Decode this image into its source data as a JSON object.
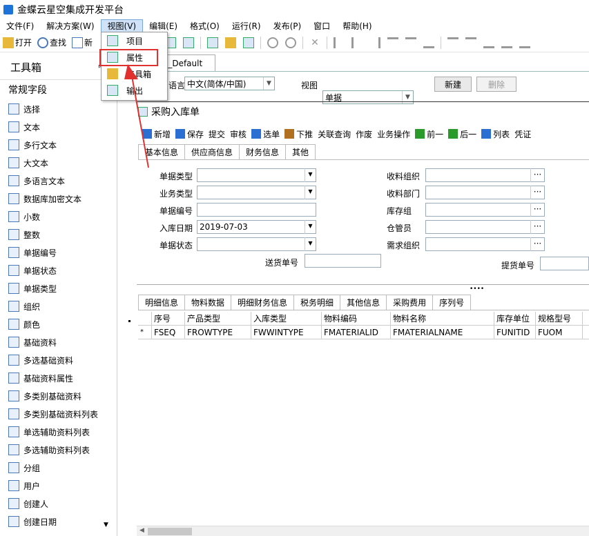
{
  "title": "金蝶云星空集成开发平台",
  "menu": [
    "文件(F)",
    "解决方案(W)",
    "视图(V)",
    "编辑(E)",
    "格式(O)",
    "运行(R)",
    "发布(P)",
    "窗口",
    "帮助(H)"
  ],
  "toolbar": {
    "open": "打开",
    "find": "查找",
    "new": "新"
  },
  "dropdown": [
    "项目",
    "属性",
    "工具箱",
    "输出"
  ],
  "toolbox": {
    "title": "工具箱",
    "pin": "ᵖ",
    "category": "常规字段",
    "items": [
      "选择",
      "文本",
      "多行文本",
      "大文本",
      "多语言文本",
      "数据库加密文本",
      "小数",
      "整数",
      "单据编号",
      "单据状态",
      "单据类型",
      "组织",
      "颜色",
      "基础资料",
      "多选基础资料",
      "基础资料属性",
      "多类别基础资料",
      "多类别基础资料列表",
      "单选辅助资料列表",
      "多选辅助资料列表",
      "分组",
      "用户",
      "创建人",
      "创建日期"
    ]
  },
  "doc_tab": "单-_Default",
  "lang_label": "语言",
  "lang_value": "中文(简体/中国)",
  "view_label": "视图",
  "view_value": "单据",
  "btn_new": "新建",
  "btn_delete": "删除",
  "form_title": "采购入库单",
  "form_toolbar": [
    "新增",
    "保存",
    "提交",
    "审核",
    "选单",
    "下推",
    "关联查询",
    "作废",
    "业务操作",
    "前一",
    "后一",
    "列表",
    "凭证"
  ],
  "form_tabs": [
    "基本信息",
    "供应商信息",
    "财务信息",
    "其他"
  ],
  "fields_left": [
    {
      "label": "单据类型",
      "value": ""
    },
    {
      "label": "业务类型",
      "value": ""
    },
    {
      "label": "单据编号",
      "value": ""
    },
    {
      "label": "入库日期",
      "value": "2019-07-03"
    },
    {
      "label": "单据状态",
      "value": ""
    }
  ],
  "fields_right": [
    "收料组织",
    "收料部门",
    "库存组",
    "仓管员",
    "需求组织"
  ],
  "deliver_label": "送货单号",
  "pickup_label": "提货单号",
  "detail_tabs": [
    "明细信息",
    "物料数据",
    "明细财务信息",
    "税务明细",
    "其他信息",
    "采购费用",
    "序列号"
  ],
  "grid_headers": [
    "序号",
    "产品类型",
    "入库类型",
    "物料编码",
    "物料名称",
    "库存单位",
    "规格型号"
  ],
  "grid_row": [
    "FSEQ",
    "FROWTYPE",
    "FWWINTYPE",
    "FMATERIALID",
    "FMATERIALNAME",
    "FUNITID",
    "FUOM"
  ],
  "grid_marker": "*"
}
